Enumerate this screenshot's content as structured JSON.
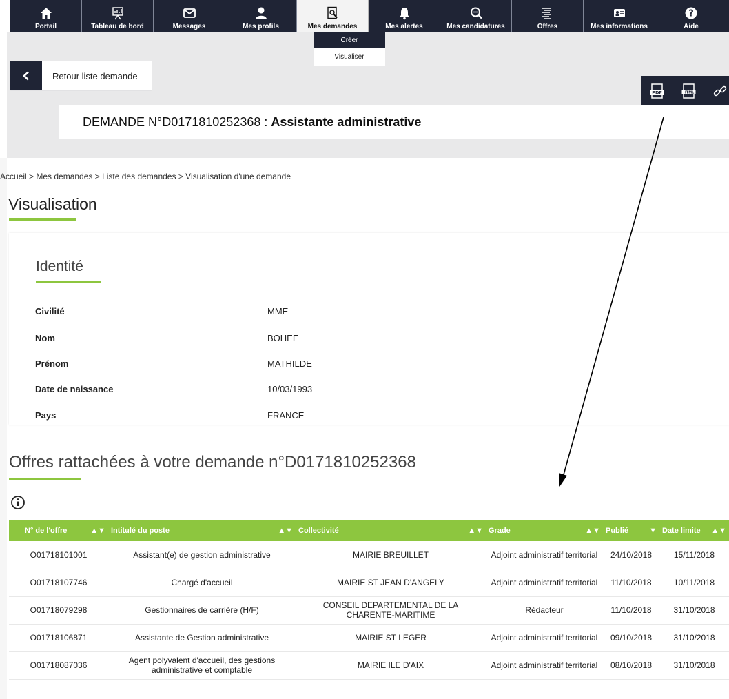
{
  "nav": [
    {
      "label": "Portail",
      "icon": "home-icon"
    },
    {
      "label": "Tableau de bord",
      "icon": "dashboard-icon"
    },
    {
      "label": "Messages",
      "icon": "envelope-icon"
    },
    {
      "label": "Mes profils",
      "icon": "user-icon"
    },
    {
      "label": "Mes demandes",
      "icon": "document-search-icon"
    },
    {
      "label": "Mes alertes",
      "icon": "bell-icon"
    },
    {
      "label": "Mes candidatures",
      "icon": "magnifier-icon"
    },
    {
      "label": "Offres",
      "icon": "list-icon"
    },
    {
      "label": "Mes informations",
      "icon": "id-card-icon"
    },
    {
      "label": "Aide",
      "icon": "help-icon"
    }
  ],
  "dropdown": {
    "create": "Créer",
    "view": "Visualiser"
  },
  "back": {
    "label": "Retour liste demande"
  },
  "tools": {
    "pdf": "PDF",
    "html": "HTML"
  },
  "header": {
    "prefix": "DEMANDE N°D0171810252368 :",
    "title": "Assistante administrative"
  },
  "breadcrumb": "Accueil > Mes demandes > Liste des demandes > Visualisation d'une demande",
  "page_title": "Visualisation",
  "identity": {
    "title": "Identité",
    "rows": [
      {
        "label": "Civilité",
        "value": "MME"
      },
      {
        "label": "Nom",
        "value": "BOHEE"
      },
      {
        "label": "Prénom",
        "value": "MATHILDE"
      },
      {
        "label": "Date de naissance",
        "value": "10/03/1993"
      },
      {
        "label": "Pays",
        "value": "FRANCE"
      }
    ]
  },
  "offers": {
    "title": "Offres rattachées à votre demande n°D0171810252368",
    "columns": [
      "N° de l'offre",
      "Intitulé du poste",
      "Collectivité",
      "Grade",
      "Publié",
      "Date limite"
    ],
    "rows": [
      [
        "O01718101001",
        "Assistant(e) de gestion administrative",
        "MAIRIE BREUILLET",
        "Adjoint administratif territorial",
        "24/10/2018",
        "15/11/2018"
      ],
      [
        "O01718107746",
        "Chargé d'accueil",
        "MAIRIE ST JEAN D'ANGELY",
        "Adjoint administratif territorial",
        "11/10/2018",
        "10/11/2018"
      ],
      [
        "O01718079298",
        "Gestionnaires de carrière (H/F)",
        "CONSEIL DEPARTEMENTAL DE LA CHARENTE-MARITIME",
        "Rédacteur",
        "11/10/2018",
        "31/10/2018"
      ],
      [
        "O01718106871",
        "Assistante de Gestion administrative",
        "MAIRIE ST LEGER",
        "Adjoint administratif territorial",
        "09/10/2018",
        "31/10/2018"
      ],
      [
        "O01718087036",
        "Agent polyvalent d'accueil, des gestions administrative et comptable",
        "MAIRIE ILE D'AIX",
        "Adjoint administratif territorial",
        "08/10/2018",
        "31/10/2018"
      ]
    ]
  },
  "colors": {
    "accent": "#8dc63f",
    "nav_bg": "#1f2435",
    "arrow": "#000000"
  }
}
